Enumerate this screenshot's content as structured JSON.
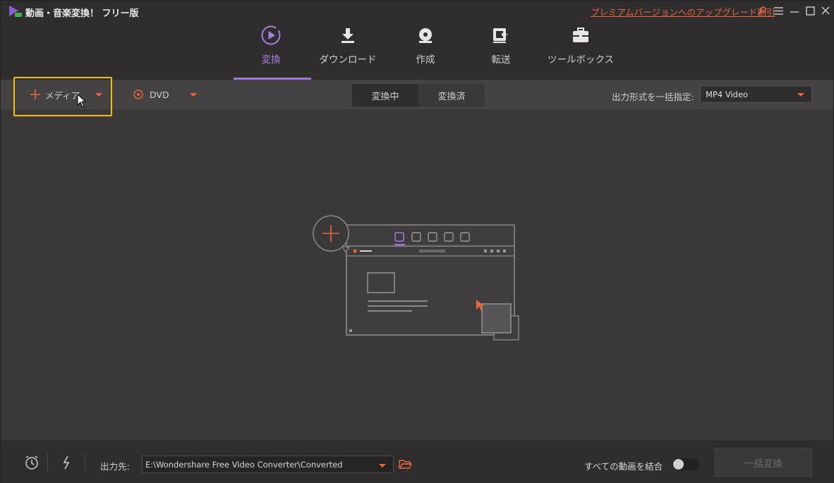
{
  "app": {
    "title": "動画・音楽変換！ フリー版"
  },
  "header": {
    "upgrade_link": "プレミアムバージョンへのアップグレード割引"
  },
  "topnav": {
    "items": [
      {
        "label": "変換",
        "icon": "convert-icon",
        "active": true
      },
      {
        "label": "ダウンロード",
        "icon": "download-icon",
        "active": false
      },
      {
        "label": "作成",
        "icon": "disc-icon",
        "active": false
      },
      {
        "label": "転送",
        "icon": "transfer-icon",
        "active": false
      },
      {
        "label": "ツールボックス",
        "icon": "toolbox-icon",
        "active": false
      }
    ]
  },
  "toolbar": {
    "add_media": "メディア",
    "dvd": "DVD",
    "tabs": [
      {
        "label": "変換中",
        "active": true
      },
      {
        "label": "変換済",
        "active": false
      }
    ],
    "format_label": "出力形式を一括指定:",
    "format_value": "MP4 Video"
  },
  "bottom": {
    "output_label": "出力先:",
    "output_path": "E:\\Wondershare Free Video Converter\\Converted",
    "merge_label": "すべての動画を結合",
    "merge_enabled": false,
    "convert_all": "一括変換"
  },
  "colors": {
    "accent_purple": "#9d7ad8",
    "accent_orange": "#e8683f",
    "highlight_yellow": "#f2c20e"
  }
}
